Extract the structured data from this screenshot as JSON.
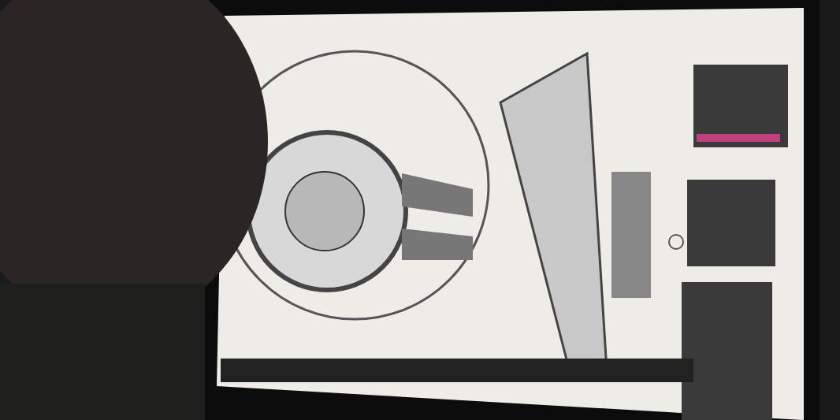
{
  "photo": {
    "kind": "monitor-scene"
  }
}
